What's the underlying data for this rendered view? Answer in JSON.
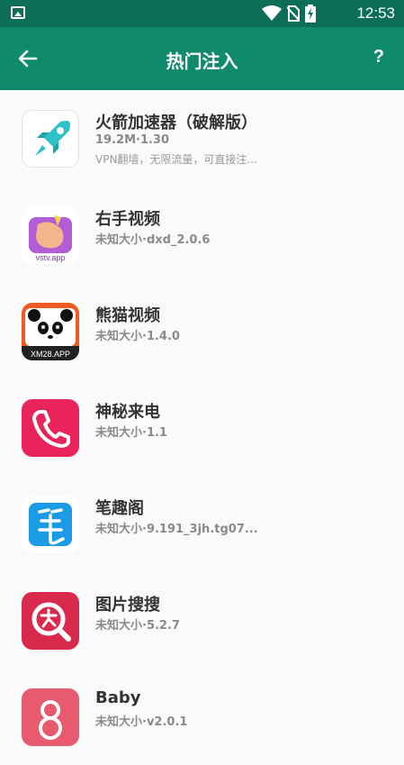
{
  "statusbar": {
    "time": "12:53",
    "icons": [
      "image-icon",
      "wifi-icon",
      "no-sim-icon",
      "battery-charging-icon"
    ]
  },
  "appbar": {
    "title": "热门注入",
    "help_label": "?",
    "back_icon": "arrow-left-icon"
  },
  "colors": {
    "statusbar_bg": "#0d6e58",
    "appbar_bg": "#0f8a6c",
    "background": "#fafafa"
  },
  "items": [
    {
      "name": "火箭加速器（破解版）",
      "meta": "19.2M·1.30",
      "desc": "VPN翻墙，无限流量，可直接注...",
      "icon": "rocket-icon"
    },
    {
      "name": "右手视频",
      "meta": "未知大小·dxd_2.0.6",
      "desc": "",
      "icon": "vstv-icon",
      "icon_label": "vstv.app"
    },
    {
      "name": "熊猫视频",
      "meta": "未知大小·1.4.0",
      "desc": "",
      "icon": "panda-icon",
      "icon_label": "XM28.APP"
    },
    {
      "name": "神秘来电",
      "meta": "未知大小·1.1",
      "desc": "",
      "icon": "phone-icon"
    },
    {
      "name": "笔趣阁",
      "meta": "未知大小·9.191_3jh.tg07...",
      "desc": "",
      "icon": "pen-icon"
    },
    {
      "name": "图片搜搜",
      "meta": "未知大小·5.2.7",
      "desc": "",
      "icon": "search-image-icon"
    },
    {
      "name": "Baby",
      "meta": "未知大小·v2.0.1",
      "desc": "",
      "icon": "baby-icon"
    }
  ]
}
